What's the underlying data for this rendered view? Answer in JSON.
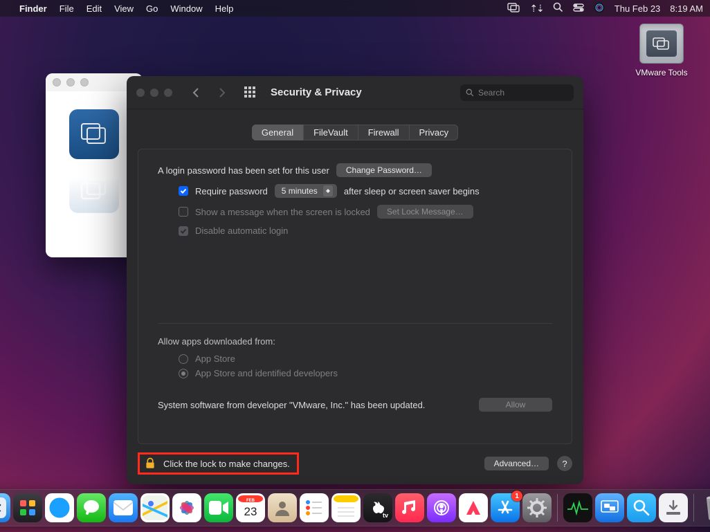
{
  "menubar": {
    "app_name": "Finder",
    "items": [
      "File",
      "Edit",
      "View",
      "Go",
      "Window",
      "Help"
    ],
    "date": "Thu Feb 23",
    "time": "8:19 AM"
  },
  "desktop": {
    "vmware_tools_label": "VMware Tools"
  },
  "sysprefs": {
    "title": "Security & Privacy",
    "search_placeholder": "Search",
    "tabs": {
      "general": "General",
      "filevault": "FileVault",
      "firewall": "Firewall",
      "privacy": "Privacy"
    },
    "login_pw_text": "A login password has been set for this user",
    "change_password_btn": "Change Password…",
    "require_password_label": "Require password",
    "require_password_delay": "5 minutes",
    "after_sleep_text": "after sleep or screen saver begins",
    "show_message_label": "Show a message when the screen is locked",
    "set_lock_message_btn": "Set Lock Message…",
    "disable_auto_login_label": "Disable automatic login",
    "allow_apps_label": "Allow apps downloaded from:",
    "app_store_label": "App Store",
    "app_store_identified_label": "App Store and identified developers",
    "system_software_text": "System software from developer \"VMware, Inc.\" has been updated.",
    "allow_btn": "Allow",
    "lock_text": "Click the lock to make changes.",
    "advanced_btn": "Advanced…",
    "help_btn": "?"
  },
  "dock": {
    "badge_count": "1"
  }
}
